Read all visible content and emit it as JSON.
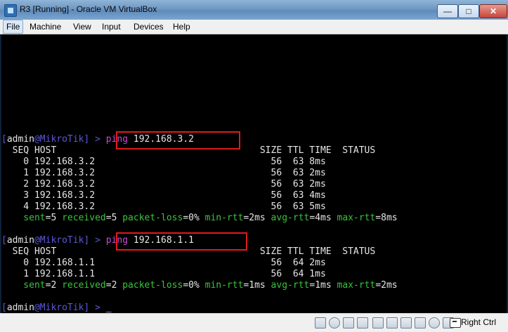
{
  "window": {
    "title": "R3 [Running] - Oracle VM VirtualBox"
  },
  "controls": {
    "minimize": "—",
    "maximize": "□",
    "close": "✕"
  },
  "menu": [
    "File",
    "Machine",
    "View",
    "Input",
    "Devices",
    "Help"
  ],
  "terminal": {
    "prompt_open": "[",
    "user": "admin",
    "at": "@",
    "host": "MikroTik",
    "prompt_close": "] > ",
    "cmd1": "ping",
    "arg1": " 192.168.3.2",
    "header": "  SEQ HOST                                     SIZE TTL TIME  STATUS",
    "rows1": [
      "    0 192.168.3.2                                56  63 8ms",
      "    1 192.168.3.2                                56  63 2ms",
      "    2 192.168.3.2                                56  63 2ms",
      "    3 192.168.3.2                                56  63 4ms",
      "    4 192.168.3.2                                56  63 5ms"
    ],
    "summary1": {
      "sent_label": "    sent",
      "sent": "5",
      "received_label": " received",
      "received": "5",
      "loss_label": " packet-loss",
      "loss": "0%",
      "min_label": " min-rtt",
      "min": "2ms",
      "avg_label": " avg-rtt",
      "avg": "4ms",
      "max_label": " max-rtt",
      "max": "8ms"
    },
    "cmd2": "ping",
    "arg2": " 192.168.1.1",
    "rows2": [
      "    0 192.168.1.1                                56  64 2ms",
      "    1 192.168.1.1                                56  64 1ms"
    ],
    "summary2": {
      "sent_label": "    sent",
      "sent": "2",
      "received_label": " received",
      "received": "2",
      "loss_label": " packet-loss",
      "loss": "0%",
      "min_label": " min-rtt",
      "min": "1ms",
      "avg_label": " avg-rtt",
      "avg": "1ms",
      "max_label": " max-rtt",
      "max": "2ms"
    },
    "cursor": "_"
  },
  "statusbar": {
    "host_key": "Right Ctrl"
  },
  "colors": {
    "highlight_box": "#e11b1b",
    "prompt_blue": "#5b57d6",
    "command_purple": "#c64bd2",
    "summary_green": "#39c53b"
  }
}
